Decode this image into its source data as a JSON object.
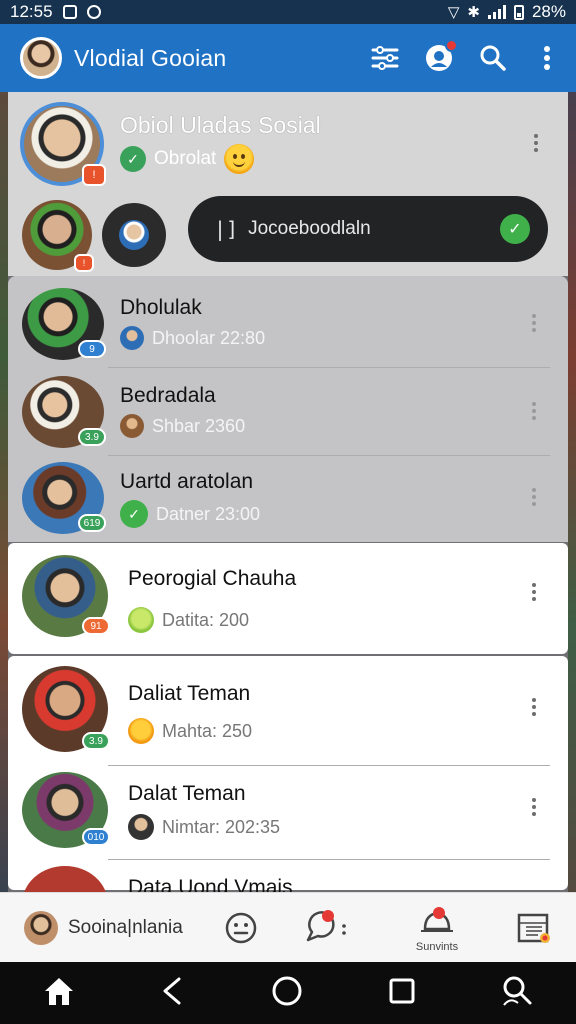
{
  "status_bar": {
    "time": "12:55",
    "battery": "28%"
  },
  "app_bar": {
    "title": "Vlodial Gooian",
    "icons": [
      "avatar",
      "filter-icon",
      "chat-notification-icon",
      "search-icon",
      "more-vert-icon"
    ]
  },
  "profile": {
    "name": "Obiol Uladas Sosial",
    "status": "Obrolat",
    "badge": "!",
    "story_badge": "!",
    "chip_icon": "|]",
    "chip_label": "Jocoeboodlaln"
  },
  "chats": [
    {
      "title": "Dholulak",
      "subtitle": "Dhoolar 22:80",
      "badge": "9",
      "style": "shaded",
      "accent": "#2f80d1"
    },
    {
      "title": "Bedradala",
      "subtitle": "Shbar 2360",
      "badge": "3.9",
      "style": "shaded",
      "accent": "#3aa15a"
    },
    {
      "title": "Uartd aratolan",
      "subtitle": "Datner 23:00",
      "badge": "619",
      "style": "shaded",
      "accent": "#3aa15a"
    },
    {
      "title": "Peorogial Chauha",
      "subtitle": "Datita: 200",
      "badge": "91",
      "style": "card",
      "accent": "#ee6a35"
    },
    {
      "title": "Daliat Teman",
      "subtitle": "Mahta: 250",
      "badge": "3.9",
      "style": "card",
      "accent": "#3aa15a"
    },
    {
      "title": "Dalat Teman",
      "subtitle": "Nimtar: 202:35",
      "badge": "010",
      "style": "card",
      "accent": "#2f80d1"
    },
    {
      "title": "Data Uond Vmais",
      "subtitle": "",
      "badge": "",
      "style": "card",
      "accent": "#2f80d1"
    }
  ],
  "bottom_tabs": {
    "profile_label": "Sooina|nlania",
    "alerts_label": "Sunvints"
  },
  "colors": {
    "app_bar": "#1f72c4",
    "status_bar": "#16324f",
    "accent_green": "#3fb04a",
    "badge_red": "#e53935"
  }
}
